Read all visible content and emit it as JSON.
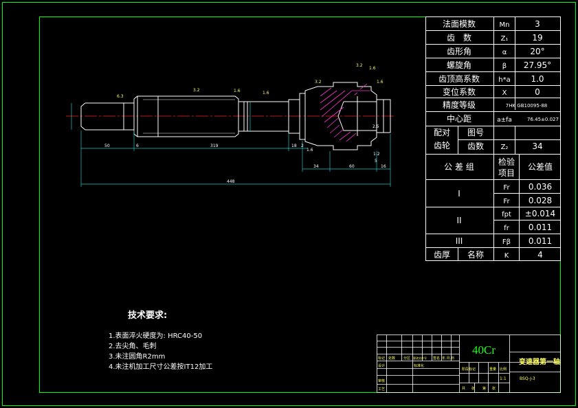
{
  "colors": {
    "background": "#000000",
    "frame": "#00ff00",
    "outline": "#ffffff",
    "centerline": "#ff2020",
    "hatch": "#ff33cc",
    "dimension": "#19c8c8",
    "text": "#ffffff",
    "material": "#00ff00"
  },
  "gear_table": [
    {
      "name": "法面模数",
      "symbol": "Mn",
      "value": "3"
    },
    {
      "name": "齿　数",
      "symbol": "Z₁",
      "value": "19"
    },
    {
      "name": "齿形角",
      "symbol": "α",
      "value": "20°"
    },
    {
      "name": "螺旋角",
      "symbol": "β",
      "value": "27.95°"
    },
    {
      "name": "齿顶高系数",
      "symbol": "h*a",
      "value": "1.0"
    },
    {
      "name": "变位系数",
      "symbol": "X",
      "value": "0"
    },
    {
      "name": "精度等级",
      "value": "7HK GB10095-88"
    },
    {
      "name": "中心距",
      "symbol": "a±fa",
      "value": "76.45±0.027"
    }
  ],
  "mating": {
    "label1": "配对",
    "label2": "齿轮",
    "drawing_no": "图号",
    "teeth": "齿数",
    "symbol": "Z₂",
    "value": "34"
  },
  "tolerance": {
    "group_header": "公 差 组",
    "check_header1": "检验",
    "check_header2": "项目",
    "value_header": "公差值",
    "rows": [
      {
        "group": "I",
        "items": [
          {
            "sym": "Fr",
            "val": "0.036"
          },
          {
            "sym": "Fr",
            "val": "0.028"
          }
        ]
      },
      {
        "group": "II",
        "items": [
          {
            "sym": "fpt",
            "val": "±0.014"
          },
          {
            "sym": "fr",
            "val": "0.011"
          }
        ]
      },
      {
        "group": "III",
        "items": [
          {
            "sym": "Fβ",
            "val": "0.011"
          }
        ]
      }
    ]
  },
  "thickness": {
    "name": "齿厚",
    "sub": "名称",
    "sym": "K",
    "val": "4"
  },
  "requirements": {
    "title": "技术要求:",
    "items": [
      "1.表面淬火硬度为: HRC40-50",
      "2.去尖角、毛刺",
      "3.未注圆角R2mm",
      "4.未注机加工尺寸公差按IT12加工"
    ]
  },
  "titleblock": {
    "material": "40Cr",
    "part_name": "变速器第一轴",
    "drawing_no": "BSQ-J-3",
    "scale": "1:1",
    "header_cells": [
      "标记",
      "处数",
      "分区",
      "更改文件号",
      "签名",
      "年.月.日"
    ],
    "row_labels": [
      "设计",
      "审核",
      "工艺"
    ],
    "mid_labels": [
      "标准化",
      "阶段标记",
      "重量",
      "比例"
    ],
    "bottom_labels": [
      "共",
      "张",
      "第",
      "张"
    ]
  },
  "dimensions": {
    "d1": "50",
    "d2": "6",
    "d3": "319",
    "d4": "448",
    "d5": "18",
    "d6": "2",
    "d7": "34",
    "d8": "60",
    "d9": "16",
    "d10": "5",
    "d11": "2.5",
    "d12": "1.2",
    "d13": "1.6"
  },
  "roughness": [
    "6.3",
    "3.2",
    "1.6",
    "1.6",
    "3.2",
    "3.2",
    "1.6",
    "1.6"
  ]
}
